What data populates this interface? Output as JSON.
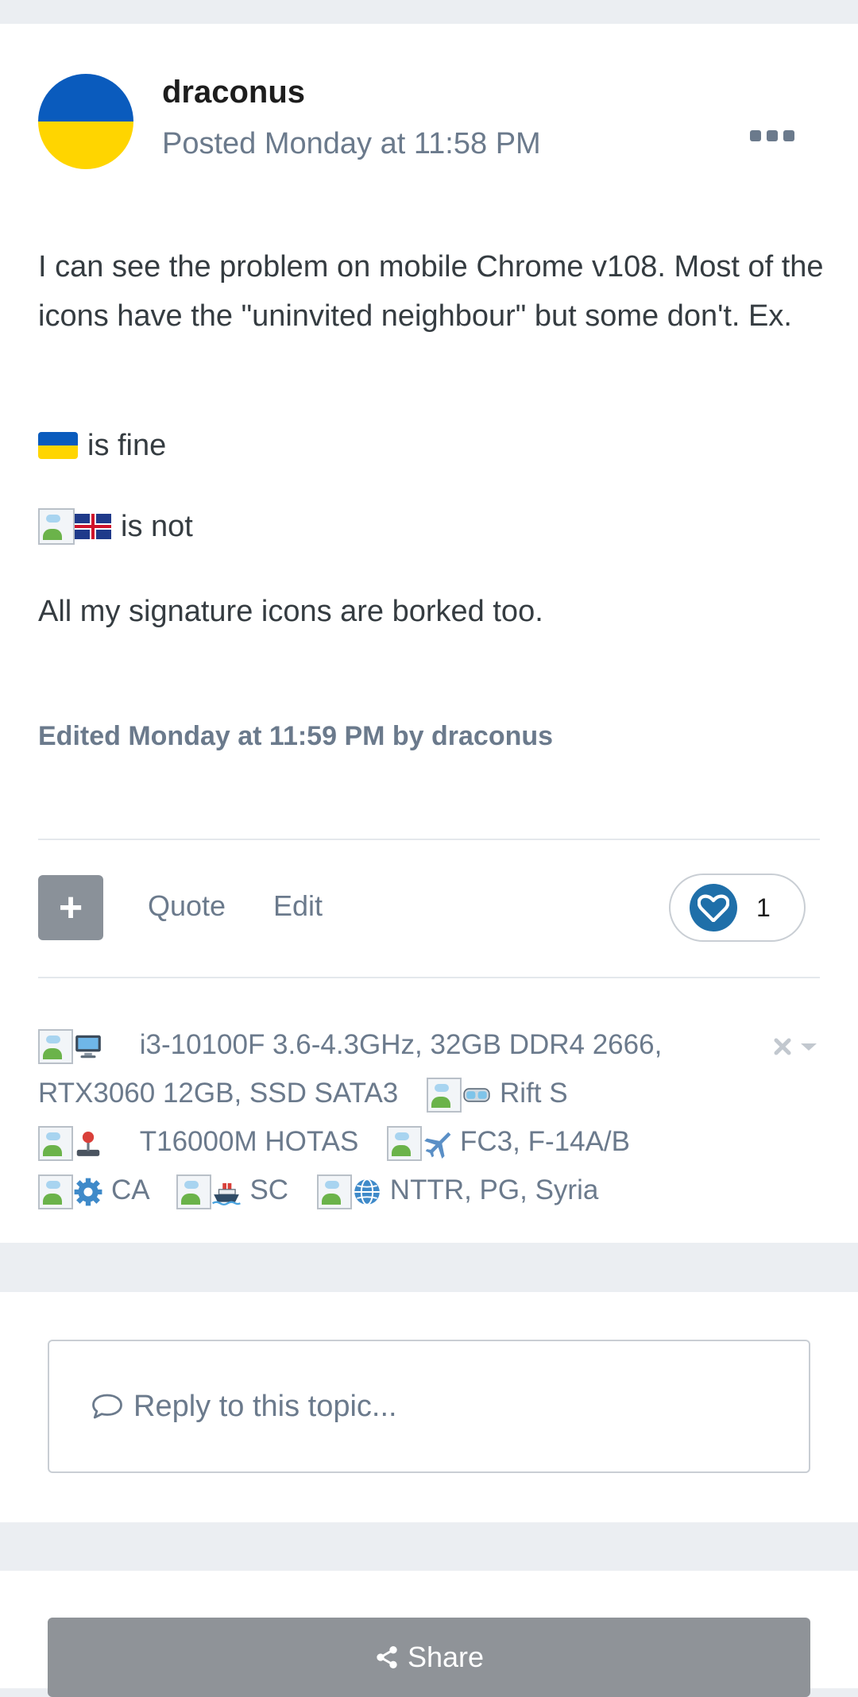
{
  "post": {
    "author": "draconus",
    "posted": "Posted Monday at 11:58 PM",
    "body": {
      "p1": "I can see the problem on mobile Chrome v108. Most of the icons have the \"uninvited neighbour\" but some don't. Ex.",
      "p2": "is fine",
      "p3": "is not",
      "p4": "All my signature icons are borked too."
    },
    "edited": "Edited Monday at 11:59 PM by draconus",
    "actions": {
      "plus": "+",
      "quote": "Quote",
      "edit": "Edit"
    },
    "reaction_count": "1",
    "signature": [
      {
        "icon": "computer-emoji",
        "text": "i3-10100F 3.6-4.3GHz, 32GB DDR4 2666, RTX3060 12GB, SSD SATA3"
      },
      {
        "icon": "vr-goggles-emoji",
        "text": "Rift S"
      },
      {
        "icon": "joystick-emoji",
        "text": "T16000M HOTAS"
      },
      {
        "icon": "airplane-emoji",
        "text": "FC3, F-14A/B"
      },
      {
        "icon": "gear-emoji",
        "text": "CA"
      },
      {
        "icon": "ship-emoji",
        "text": "SC"
      },
      {
        "icon": "globe-emoji",
        "text": "NTTR, PG, Syria"
      }
    ]
  },
  "reply": {
    "placeholder": "Reply to this topic..."
  },
  "share": {
    "label": "Share"
  },
  "colors": {
    "accent": "#1f6fa9",
    "muted_text": "#6b7a8c",
    "button_gray": "#8a9199"
  }
}
